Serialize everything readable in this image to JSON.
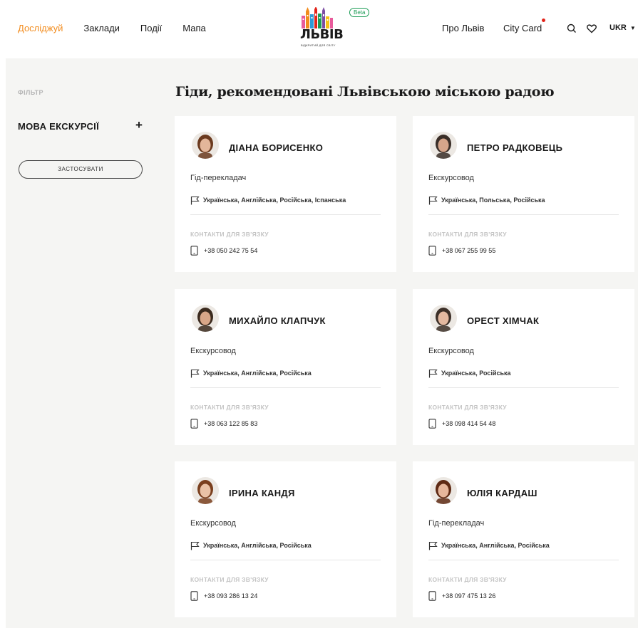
{
  "nav": {
    "explore": "Досліджуй",
    "places": "Заклади",
    "events": "Події",
    "map": "Мапа",
    "about": "Про Львів",
    "city_card": "City Card",
    "lang": "UKR"
  },
  "logo": {
    "beta": "Beta",
    "word": "ЛЬВІВ",
    "tagline": "ВІДКРИТИЙ ДЛЯ СВІТУ"
  },
  "filter": {
    "label": "ФІЛЬТР",
    "section": "МОВА ЕКСКУРСІЇ",
    "expand": "+",
    "apply": "ЗАСТОСУВАТИ"
  },
  "page_title": "Гіди, рекомендовані Львівською міською радою",
  "contacts_label": "КОНТАКТИ ДЛЯ ЗВ'ЯЗКУ",
  "guides": [
    {
      "name": "ДІАНА БОРИСЕНКО",
      "role": "Гід-перекладач",
      "languages": "Українська, Англійська, Російська, Іспанська",
      "phone": "+38 050 242 75 54",
      "hair": "#6b3a1f",
      "skin": "#e3b69a"
    },
    {
      "name": "ПЕТРО РАДКОВЕЦЬ",
      "role": "Екскурсовод",
      "languages": "Українська, Польська, Російська",
      "phone": "+38 067 255 99 55",
      "hair": "#3a2e28",
      "skin": "#d6a58a"
    },
    {
      "name": "МИХАЙЛО КЛАПЧУК",
      "role": "Екскурсовод",
      "languages": "Українська, Англійська, Російська",
      "phone": "+38 063 122 85 83",
      "hair": "#3b2a1e",
      "skin": "#d8a688"
    },
    {
      "name": "ОРЕСТ ХІМЧАК",
      "role": "Екскурсовод",
      "languages": "Українська, Російська",
      "phone": "+38 098 414 54 48",
      "hair": "#3d3028",
      "skin": "#e4b9a0"
    },
    {
      "name": "ІРИНА КАНДЯ",
      "role": "Екскурсовод",
      "languages": "Українська, Англійська, Російська",
      "phone": "+38 093 286 13 24",
      "hair": "#7a3f1e",
      "skin": "#eac2a6"
    },
    {
      "name": "ЮЛІЯ КАРДАШ",
      "role": "Гід-перекладач",
      "languages": "Українська, Англійська, Російська",
      "phone": "+38 097 475 13 26",
      "hair": "#5e2a14",
      "skin": "#e6b79c"
    }
  ],
  "colors": {
    "accent": "#f28c1e",
    "beta_green": "#1a9b54",
    "notification_dot": "#e2231a",
    "background": "#f5f5f3"
  }
}
